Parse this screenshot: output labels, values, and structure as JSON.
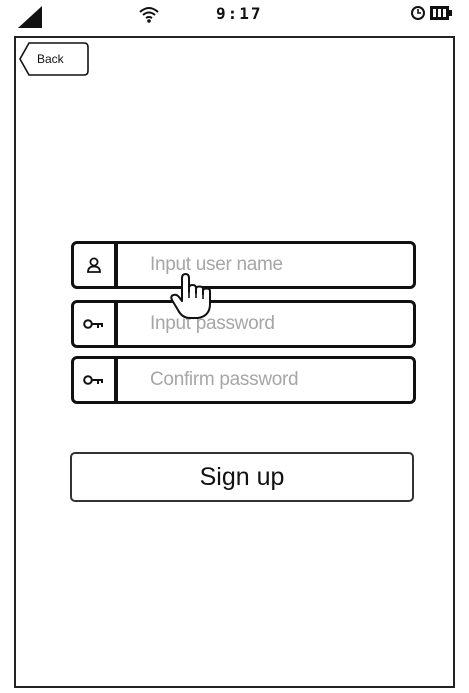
{
  "status_bar": {
    "time": "9:17",
    "icons": [
      "signal-icon",
      "wifi-icon",
      "alarm-icon",
      "battery-icon"
    ]
  },
  "back_button": {
    "label": "Back"
  },
  "form": {
    "username": {
      "icon": "user-icon",
      "placeholder": "Input user name"
    },
    "password": {
      "icon": "key-icon",
      "placeholder": "Input password"
    },
    "confirm_password": {
      "icon": "key-icon",
      "placeholder": "Confirm password"
    }
  },
  "signup_button": {
    "label": "Sign up"
  },
  "pointer": {
    "icon": "hand-pointer-icon"
  }
}
